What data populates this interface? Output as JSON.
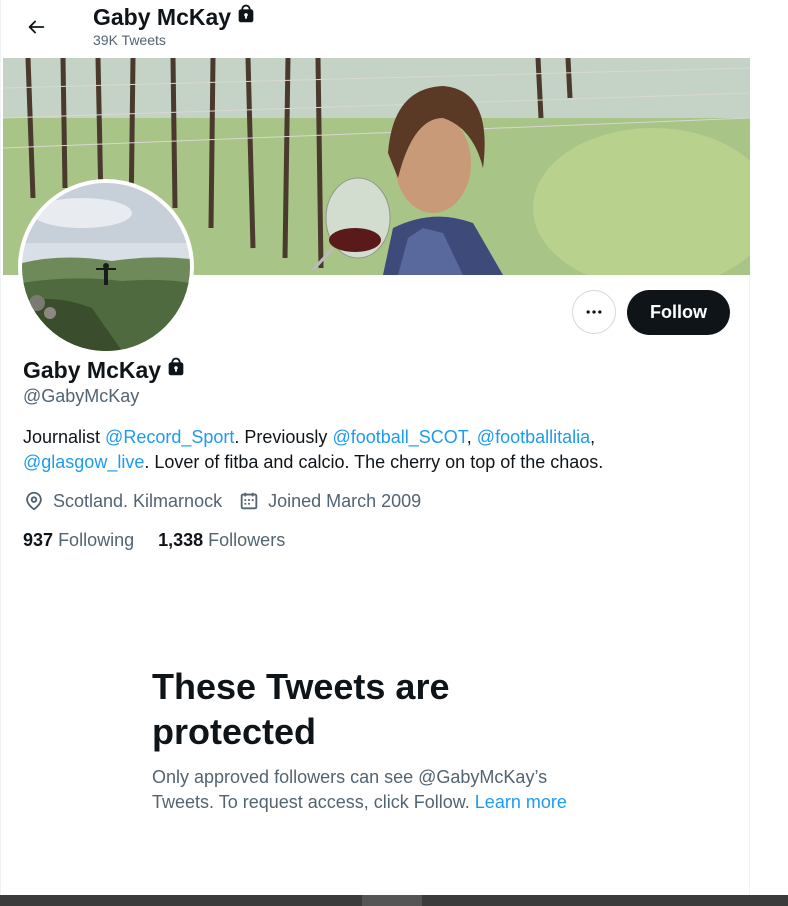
{
  "header": {
    "name": "Gaby McKay",
    "tweet_count": "39K Tweets"
  },
  "profile": {
    "display_name": "Gaby McKay",
    "handle": "@GabyMcKay",
    "bio": {
      "t1": "Journalist ",
      "m1": "@Record_Sport",
      "t2": ". Previously ",
      "m2": "@football_SCOT",
      "t3": ", ",
      "m3": "@footballitalia",
      "t4": ",",
      "m4": "@glasgow_live",
      "t5": ". Lover of fitba and calcio. The cherry on top of the chaos."
    },
    "location": "Scotland. Kilmarnock",
    "joined": "Joined March 2009",
    "following_count": "937",
    "following_label": "Following",
    "followers_count": "1,338",
    "followers_label": "Followers"
  },
  "actions": {
    "follow_label": "Follow"
  },
  "protected": {
    "title": "These Tweets are protected",
    "body": "Only approved followers can see @GabyMcKay’s Tweets. To request access, click Follow. ",
    "link": "Learn more"
  },
  "colors": {
    "accent": "#1d9bf0",
    "text": "#0f1419",
    "secondary": "#536471",
    "follow_bg": "#0f1419"
  },
  "icons": [
    "back-arrow-icon",
    "lock-icon",
    "more-icon",
    "location-icon",
    "calendar-icon"
  ]
}
